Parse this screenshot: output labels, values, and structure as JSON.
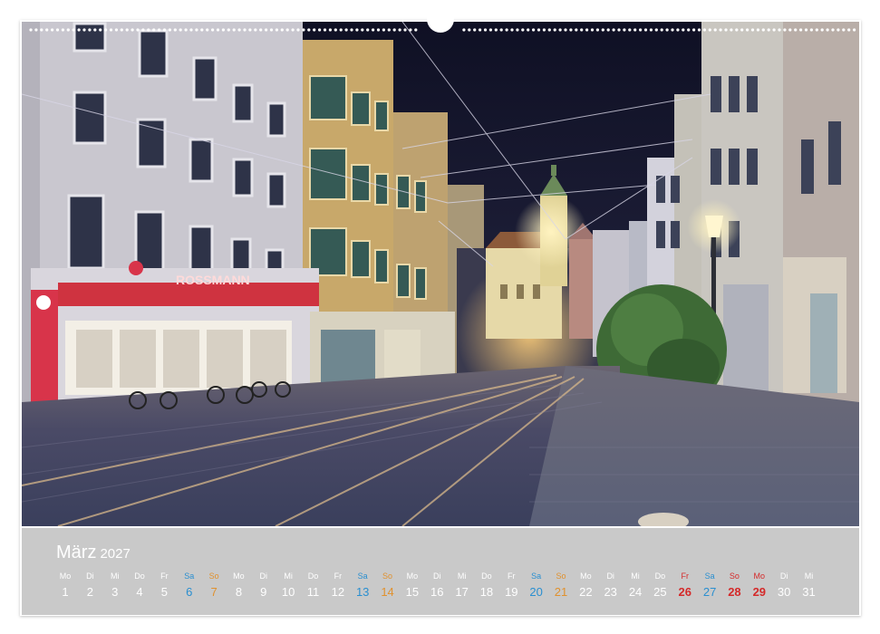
{
  "calendar": {
    "month": "März",
    "year": "2027",
    "days": [
      {
        "dow": "Mo",
        "num": "1",
        "type": "weekday"
      },
      {
        "dow": "Di",
        "num": "2",
        "type": "weekday"
      },
      {
        "dow": "Mi",
        "num": "3",
        "type": "weekday"
      },
      {
        "dow": "Do",
        "num": "4",
        "type": "weekday"
      },
      {
        "dow": "Fr",
        "num": "5",
        "type": "weekday"
      },
      {
        "dow": "Sa",
        "num": "6",
        "type": "saturday"
      },
      {
        "dow": "So",
        "num": "7",
        "type": "sunday"
      },
      {
        "dow": "Mo",
        "num": "8",
        "type": "weekday"
      },
      {
        "dow": "Di",
        "num": "9",
        "type": "weekday"
      },
      {
        "dow": "Mi",
        "num": "10",
        "type": "weekday"
      },
      {
        "dow": "Do",
        "num": "11",
        "type": "weekday"
      },
      {
        "dow": "Fr",
        "num": "12",
        "type": "weekday"
      },
      {
        "dow": "Sa",
        "num": "13",
        "type": "saturday"
      },
      {
        "dow": "So",
        "num": "14",
        "type": "sunday"
      },
      {
        "dow": "Mo",
        "num": "15",
        "type": "weekday"
      },
      {
        "dow": "Di",
        "num": "16",
        "type": "weekday"
      },
      {
        "dow": "Mi",
        "num": "17",
        "type": "weekday"
      },
      {
        "dow": "Do",
        "num": "18",
        "type": "weekday"
      },
      {
        "dow": "Fr",
        "num": "19",
        "type": "weekday"
      },
      {
        "dow": "Sa",
        "num": "20",
        "type": "saturday"
      },
      {
        "dow": "So",
        "num": "21",
        "type": "sunday"
      },
      {
        "dow": "Mo",
        "num": "22",
        "type": "weekday"
      },
      {
        "dow": "Di",
        "num": "23",
        "type": "weekday"
      },
      {
        "dow": "Mi",
        "num": "24",
        "type": "weekday"
      },
      {
        "dow": "Do",
        "num": "25",
        "type": "weekday"
      },
      {
        "dow": "Fr",
        "num": "26",
        "type": "holiday"
      },
      {
        "dow": "Sa",
        "num": "27",
        "type": "saturday"
      },
      {
        "dow": "So",
        "num": "28",
        "type": "holiday"
      },
      {
        "dow": "Mo",
        "num": "29",
        "type": "holiday"
      },
      {
        "dow": "Di",
        "num": "30",
        "type": "weekday"
      },
      {
        "dow": "Mi",
        "num": "31",
        "type": "weekday"
      }
    ]
  },
  "photo": {
    "shop_sign": "ROSSMANN"
  },
  "colors": {
    "calendar_bg": "#c9c9c9",
    "saturday": "#2a8fd0",
    "sunday": "#e0912e",
    "holiday": "#d42a2a"
  }
}
